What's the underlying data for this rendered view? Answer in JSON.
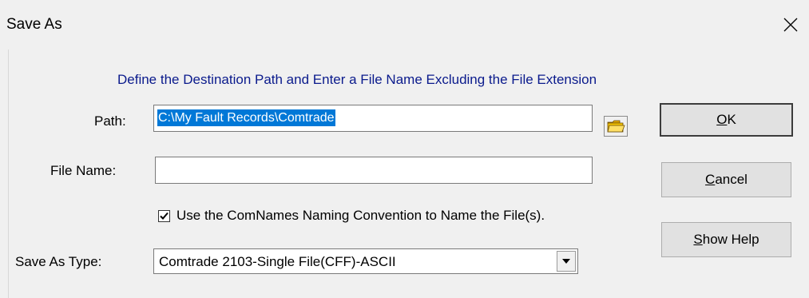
{
  "window": {
    "title": "Save As",
    "close_icon": "close-icon"
  },
  "dialog": {
    "instruction": "Define the Destination Path and Enter a File Name Excluding the File Extension",
    "path": {
      "label": "Path:",
      "value": "C:\\My Fault Records\\Comtrade",
      "browse_icon": "folder-icon"
    },
    "file_name": {
      "label": "File Name:",
      "value": ""
    },
    "naming_convention": {
      "checked": true,
      "label": "Use the ComNames Naming Convention to Name the  File(s)."
    },
    "save_as_type": {
      "label": "Save As Type:",
      "selected": "Comtrade 2103-Single File(CFF)-ASCII",
      "arrow_icon": "chevron-down-icon"
    }
  },
  "buttons": {
    "ok": {
      "label": "OK",
      "accel": "O",
      "rest": "K"
    },
    "cancel": {
      "label": "Cancel",
      "accel": "C",
      "rest": "ancel"
    },
    "help": {
      "label": "Show Help",
      "accel": "S",
      "rest": "how Help"
    }
  },
  "colors": {
    "instruction_text": "#0a1a8c",
    "selection_highlight": "#0078d7",
    "dialog_background": "#f0f0f0"
  }
}
